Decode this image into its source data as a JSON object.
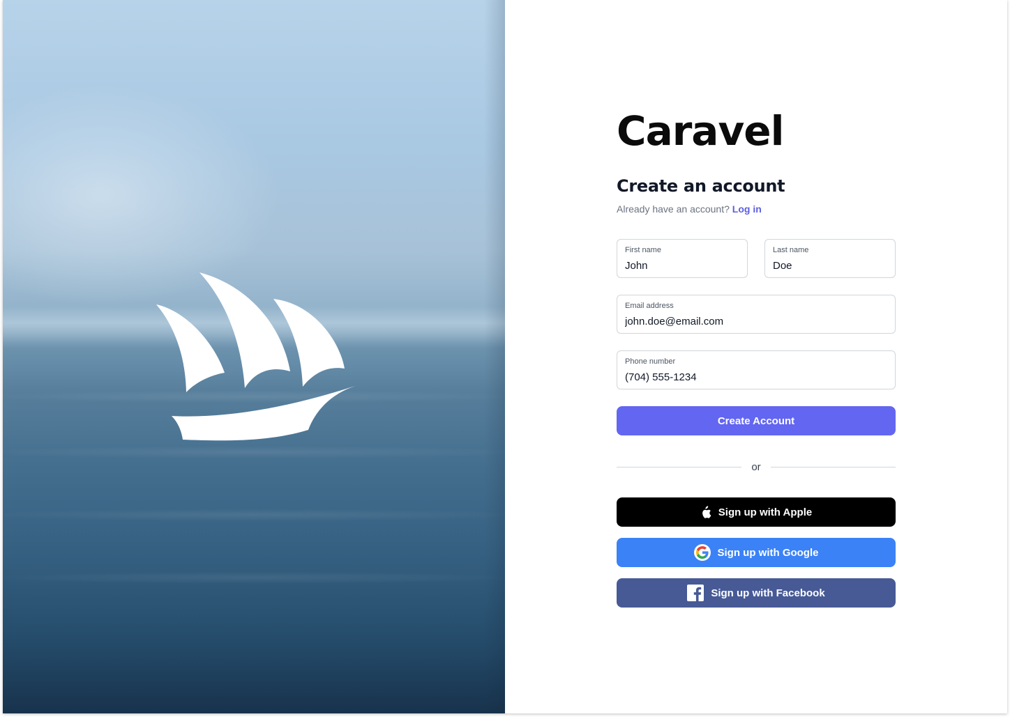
{
  "brand": {
    "name": "Caravel"
  },
  "form": {
    "heading": "Create an account",
    "subline": "Already have an account?",
    "login_link": "Log in",
    "first_name": {
      "label": "First name",
      "value": "John"
    },
    "last_name": {
      "label": "Last name",
      "value": "Doe"
    },
    "email": {
      "label": "Email address",
      "value": "john.doe@email.com"
    },
    "phone": {
      "label": "Phone number",
      "value": "(704) 555-1234"
    },
    "submit_label": "Create Account",
    "divider_text": "or"
  },
  "social": {
    "apple_label": "Sign up with Apple",
    "google_label": "Sign up with Google",
    "facebook_label": "Sign up with Facebook"
  },
  "icons": {
    "logo": "sailing-ship-icon",
    "apple": "apple-icon",
    "google": "google-icon",
    "facebook": "facebook-icon"
  },
  "colors": {
    "accent": "#6366f1",
    "link": "#5b5fe0",
    "apple_button": "#000000",
    "google_button": "#3b82f6",
    "facebook_button": "#475a96"
  }
}
